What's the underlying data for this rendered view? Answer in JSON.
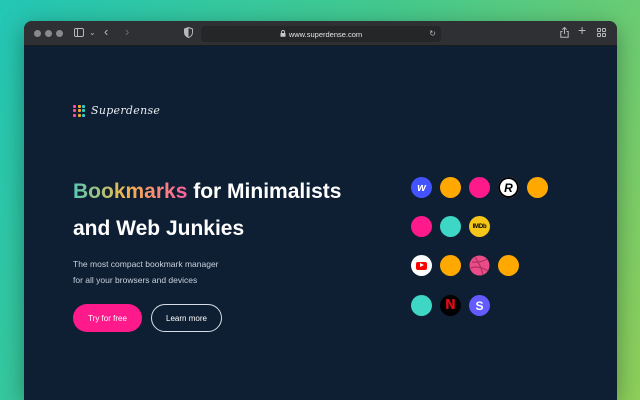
{
  "browser": {
    "url": "www.superdense.com"
  },
  "logo": {
    "text": "Superdense",
    "dot_colors": [
      "#ff4fa3",
      "#f9a826",
      "#2ed3c2",
      "#ff4fa3",
      "#f9a826",
      "#2ed3c2",
      "#ff4fa3",
      "#f9a826",
      "#2ed3c2"
    ]
  },
  "hero": {
    "headline_highlight": "Bookmarks",
    "headline_rest_line1": " for Minimalists",
    "headline_line2": "and Web Junkies",
    "subtitle_line1": "The most compact bookmark manager",
    "subtitle_line2": "for all your browsers and devices",
    "primary_button": "Try for free",
    "secondary_button": "Learn more"
  },
  "bookmark_icons": [
    {
      "name": "webflow-icon",
      "glyph": "w",
      "bg": "#4353ff",
      "fg": "#ffffff"
    },
    {
      "name": "orange-dot-icon",
      "glyph": "",
      "bg": "#ffa800",
      "fg": ""
    },
    {
      "name": "pink-dot-icon",
      "glyph": "",
      "bg": "#ff1a8c",
      "fg": ""
    },
    {
      "name": "r-logo-icon",
      "glyph": "R",
      "bg": "#ffffff",
      "fg": "#000000"
    },
    {
      "name": "orange-dot-icon",
      "glyph": "",
      "bg": "#ffa800",
      "fg": ""
    },
    {
      "name": "pink-dot-icon",
      "glyph": "",
      "bg": "#ff1a8c",
      "fg": ""
    },
    {
      "name": "teal-dot-icon",
      "glyph": "",
      "bg": "#3ed7c6",
      "fg": ""
    },
    {
      "name": "imdb-icon",
      "glyph": "IMDb",
      "bg": "#f5c518",
      "fg": "#000000"
    },
    {
      "name": "youtube-icon",
      "glyph": "▶",
      "bg": "#ff0000",
      "fg": "#ffffff"
    },
    {
      "name": "orange-dot-icon",
      "glyph": "",
      "bg": "#ffa800",
      "fg": ""
    },
    {
      "name": "dribbble-icon",
      "glyph": "",
      "bg": "#ea4c89",
      "fg": ""
    },
    {
      "name": "orange-dot-icon",
      "glyph": "",
      "bg": "#ffa800",
      "fg": ""
    },
    {
      "name": "teal-dot-icon",
      "glyph": "",
      "bg": "#3ed7c6",
      "fg": ""
    },
    {
      "name": "netflix-icon",
      "glyph": "N",
      "bg": "#000000",
      "fg": "#e50914"
    },
    {
      "name": "s-logo-icon",
      "glyph": "S",
      "bg": "#635bff",
      "fg": "#ffffff"
    }
  ],
  "colors": {
    "page_bg": "#0f1f33",
    "accent_pink": "#ff1a8c"
  }
}
